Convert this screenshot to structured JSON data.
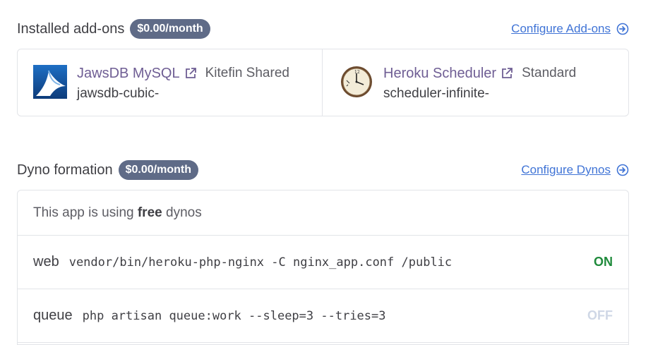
{
  "addons": {
    "title": "Installed add-ons",
    "price": "$0.00/month",
    "configure_label": "Configure Add-ons",
    "items": [
      {
        "name": "JawsDB MySQL",
        "plan": "Kitefin Shared",
        "app": "jawsdb-cubic-",
        "icon": "jawsdb-icon"
      },
      {
        "name": "Heroku Scheduler",
        "plan": "Standard",
        "app": "scheduler-infinite-",
        "icon": "scheduler-clock-icon"
      }
    ]
  },
  "dynos": {
    "title": "Dyno formation",
    "price": "$0.00/month",
    "configure_label": "Configure Dynos",
    "notice_prefix": "This app is using ",
    "notice_bold": "free",
    "notice_suffix": " dynos",
    "rows": [
      {
        "type": "web",
        "command": "vendor/bin/heroku-php-nginx -C nginx_app.conf /public",
        "state": "ON"
      },
      {
        "type": "queue",
        "command": "php artisan queue:work --sleep=3 --tries=3",
        "state": "OFF"
      }
    ]
  },
  "colors": {
    "link": "#4074d6",
    "badge": "#5f6b87",
    "addon_name": "#6f5e94",
    "on": "#1f8a3b",
    "off": "#cfd7e6"
  }
}
